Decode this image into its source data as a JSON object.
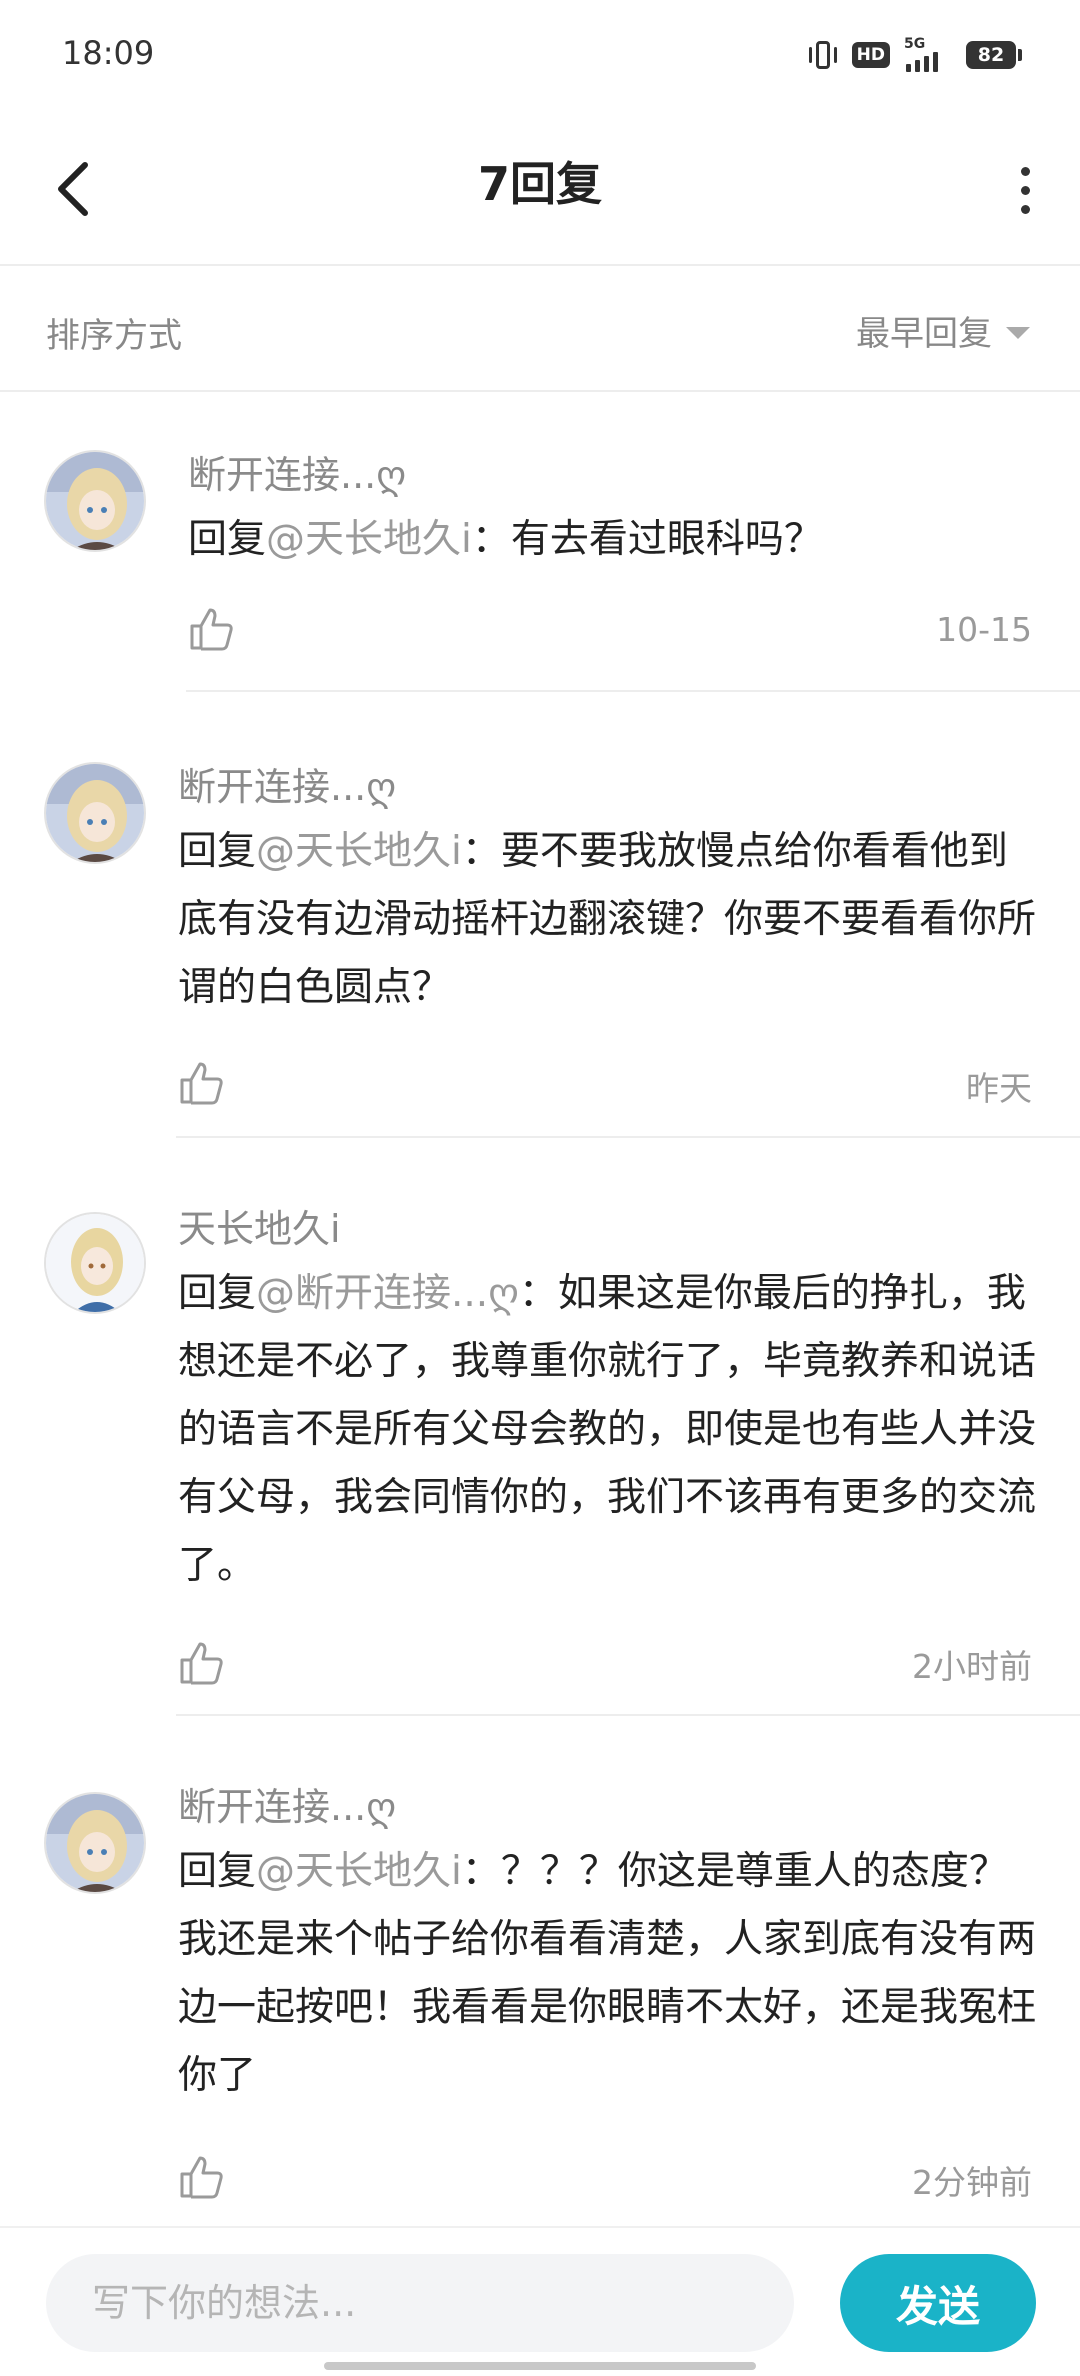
{
  "status_bar": {
    "time": "18:09",
    "hd": "HD",
    "network": "5G",
    "battery": "82"
  },
  "header": {
    "title": "7回复"
  },
  "sort": {
    "label": "排序方式",
    "selected": "最早回复"
  },
  "comments": [
    {
      "name": "断开连接...ღ",
      "reply_prefix": "回复",
      "mention": "@天长地久i",
      "body": "：有去看过眼科吗？",
      "time": "10-15"
    },
    {
      "name": "断开连接...ღ",
      "reply_prefix": "回复",
      "mention": "@天长地久i",
      "body": "：要不要我放慢点给你看看他到底有没有边滑动摇杆边翻滚键？你要不要看看你所谓的白色圆点？",
      "time": "昨天"
    },
    {
      "name": "天长地久i",
      "reply_prefix": "回复",
      "mention": "@断开连接...ღ",
      "body": "：如果这是你最后的挣扎，我想还是不必了，我尊重你就行了，毕竟教养和说话的语言不是所有父母会教的，即使是也有些人并没有父母，我会同情你的，我们不该再有更多的交流了。",
      "time": "2小时前"
    },
    {
      "name": "断开连接...ღ",
      "reply_prefix": "回复",
      "mention": "@天长地久i",
      "body": "：？？？你这是尊重人的态度？我还是来个帖子给你看看清楚，人家到底有没有两边一起按吧！我看看是你眼睛不太好，还是我冤枉你了",
      "time": "2分钟前"
    }
  ],
  "composer": {
    "placeholder": "写下你的想法...",
    "send_label": "发送"
  },
  "colors": {
    "accent": "#1ab3c8",
    "mention": "#9a9a9a",
    "muted": "#8a8a8a"
  }
}
